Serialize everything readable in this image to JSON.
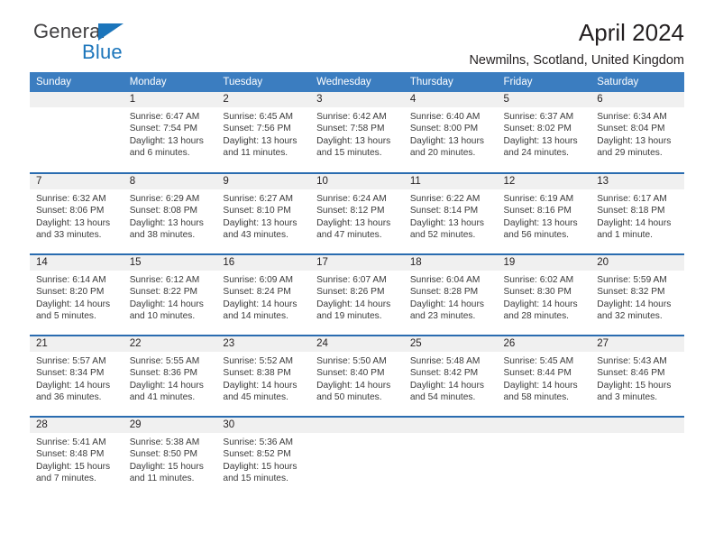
{
  "brand": {
    "line1": "General",
    "line2": "Blue",
    "triangle_icon": "triangle-icon",
    "color": "#1b75bb"
  },
  "header": {
    "title": "April 2024",
    "subtitle": "Newmilns, Scotland, United Kingdom"
  },
  "calendar": {
    "header_bg": "#3b7dc0",
    "row_divider_color": "#2a6cb0",
    "daynum_bg": "#f0f0f0",
    "weekdays": [
      "Sunday",
      "Monday",
      "Tuesday",
      "Wednesday",
      "Thursday",
      "Friday",
      "Saturday"
    ],
    "weeks": [
      [
        {
          "day": "",
          "empty": true,
          "sunrise": "",
          "sunset": "",
          "daylight": ""
        },
        {
          "day": "1",
          "sunrise": "Sunrise: 6:47 AM",
          "sunset": "Sunset: 7:54 PM",
          "daylight": "Daylight: 13 hours and 6 minutes."
        },
        {
          "day": "2",
          "sunrise": "Sunrise: 6:45 AM",
          "sunset": "Sunset: 7:56 PM",
          "daylight": "Daylight: 13 hours and 11 minutes."
        },
        {
          "day": "3",
          "sunrise": "Sunrise: 6:42 AM",
          "sunset": "Sunset: 7:58 PM",
          "daylight": "Daylight: 13 hours and 15 minutes."
        },
        {
          "day": "4",
          "sunrise": "Sunrise: 6:40 AM",
          "sunset": "Sunset: 8:00 PM",
          "daylight": "Daylight: 13 hours and 20 minutes."
        },
        {
          "day": "5",
          "sunrise": "Sunrise: 6:37 AM",
          "sunset": "Sunset: 8:02 PM",
          "daylight": "Daylight: 13 hours and 24 minutes."
        },
        {
          "day": "6",
          "sunrise": "Sunrise: 6:34 AM",
          "sunset": "Sunset: 8:04 PM",
          "daylight": "Daylight: 13 hours and 29 minutes."
        }
      ],
      [
        {
          "day": "7",
          "sunrise": "Sunrise: 6:32 AM",
          "sunset": "Sunset: 8:06 PM",
          "daylight": "Daylight: 13 hours and 33 minutes."
        },
        {
          "day": "8",
          "sunrise": "Sunrise: 6:29 AM",
          "sunset": "Sunset: 8:08 PM",
          "daylight": "Daylight: 13 hours and 38 minutes."
        },
        {
          "day": "9",
          "sunrise": "Sunrise: 6:27 AM",
          "sunset": "Sunset: 8:10 PM",
          "daylight": "Daylight: 13 hours and 43 minutes."
        },
        {
          "day": "10",
          "sunrise": "Sunrise: 6:24 AM",
          "sunset": "Sunset: 8:12 PM",
          "daylight": "Daylight: 13 hours and 47 minutes."
        },
        {
          "day": "11",
          "sunrise": "Sunrise: 6:22 AM",
          "sunset": "Sunset: 8:14 PM",
          "daylight": "Daylight: 13 hours and 52 minutes."
        },
        {
          "day": "12",
          "sunrise": "Sunrise: 6:19 AM",
          "sunset": "Sunset: 8:16 PM",
          "daylight": "Daylight: 13 hours and 56 minutes."
        },
        {
          "day": "13",
          "sunrise": "Sunrise: 6:17 AM",
          "sunset": "Sunset: 8:18 PM",
          "daylight": "Daylight: 14 hours and 1 minute."
        }
      ],
      [
        {
          "day": "14",
          "sunrise": "Sunrise: 6:14 AM",
          "sunset": "Sunset: 8:20 PM",
          "daylight": "Daylight: 14 hours and 5 minutes."
        },
        {
          "day": "15",
          "sunrise": "Sunrise: 6:12 AM",
          "sunset": "Sunset: 8:22 PM",
          "daylight": "Daylight: 14 hours and 10 minutes."
        },
        {
          "day": "16",
          "sunrise": "Sunrise: 6:09 AM",
          "sunset": "Sunset: 8:24 PM",
          "daylight": "Daylight: 14 hours and 14 minutes."
        },
        {
          "day": "17",
          "sunrise": "Sunrise: 6:07 AM",
          "sunset": "Sunset: 8:26 PM",
          "daylight": "Daylight: 14 hours and 19 minutes."
        },
        {
          "day": "18",
          "sunrise": "Sunrise: 6:04 AM",
          "sunset": "Sunset: 8:28 PM",
          "daylight": "Daylight: 14 hours and 23 minutes."
        },
        {
          "day": "19",
          "sunrise": "Sunrise: 6:02 AM",
          "sunset": "Sunset: 8:30 PM",
          "daylight": "Daylight: 14 hours and 28 minutes."
        },
        {
          "day": "20",
          "sunrise": "Sunrise: 5:59 AM",
          "sunset": "Sunset: 8:32 PM",
          "daylight": "Daylight: 14 hours and 32 minutes."
        }
      ],
      [
        {
          "day": "21",
          "sunrise": "Sunrise: 5:57 AM",
          "sunset": "Sunset: 8:34 PM",
          "daylight": "Daylight: 14 hours and 36 minutes."
        },
        {
          "day": "22",
          "sunrise": "Sunrise: 5:55 AM",
          "sunset": "Sunset: 8:36 PM",
          "daylight": "Daylight: 14 hours and 41 minutes."
        },
        {
          "day": "23",
          "sunrise": "Sunrise: 5:52 AM",
          "sunset": "Sunset: 8:38 PM",
          "daylight": "Daylight: 14 hours and 45 minutes."
        },
        {
          "day": "24",
          "sunrise": "Sunrise: 5:50 AM",
          "sunset": "Sunset: 8:40 PM",
          "daylight": "Daylight: 14 hours and 50 minutes."
        },
        {
          "day": "25",
          "sunrise": "Sunrise: 5:48 AM",
          "sunset": "Sunset: 8:42 PM",
          "daylight": "Daylight: 14 hours and 54 minutes."
        },
        {
          "day": "26",
          "sunrise": "Sunrise: 5:45 AM",
          "sunset": "Sunset: 8:44 PM",
          "daylight": "Daylight: 14 hours and 58 minutes."
        },
        {
          "day": "27",
          "sunrise": "Sunrise: 5:43 AM",
          "sunset": "Sunset: 8:46 PM",
          "daylight": "Daylight: 15 hours and 3 minutes."
        }
      ],
      [
        {
          "day": "28",
          "sunrise": "Sunrise: 5:41 AM",
          "sunset": "Sunset: 8:48 PM",
          "daylight": "Daylight: 15 hours and 7 minutes."
        },
        {
          "day": "29",
          "sunrise": "Sunrise: 5:38 AM",
          "sunset": "Sunset: 8:50 PM",
          "daylight": "Daylight: 15 hours and 11 minutes."
        },
        {
          "day": "30",
          "sunrise": "Sunrise: 5:36 AM",
          "sunset": "Sunset: 8:52 PM",
          "daylight": "Daylight: 15 hours and 15 minutes."
        },
        {
          "day": "",
          "empty": true,
          "sunrise": "",
          "sunset": "",
          "daylight": ""
        },
        {
          "day": "",
          "empty": true,
          "sunrise": "",
          "sunset": "",
          "daylight": ""
        },
        {
          "day": "",
          "empty": true,
          "sunrise": "",
          "sunset": "",
          "daylight": ""
        },
        {
          "day": "",
          "empty": true,
          "sunrise": "",
          "sunset": "",
          "daylight": ""
        }
      ]
    ]
  }
}
